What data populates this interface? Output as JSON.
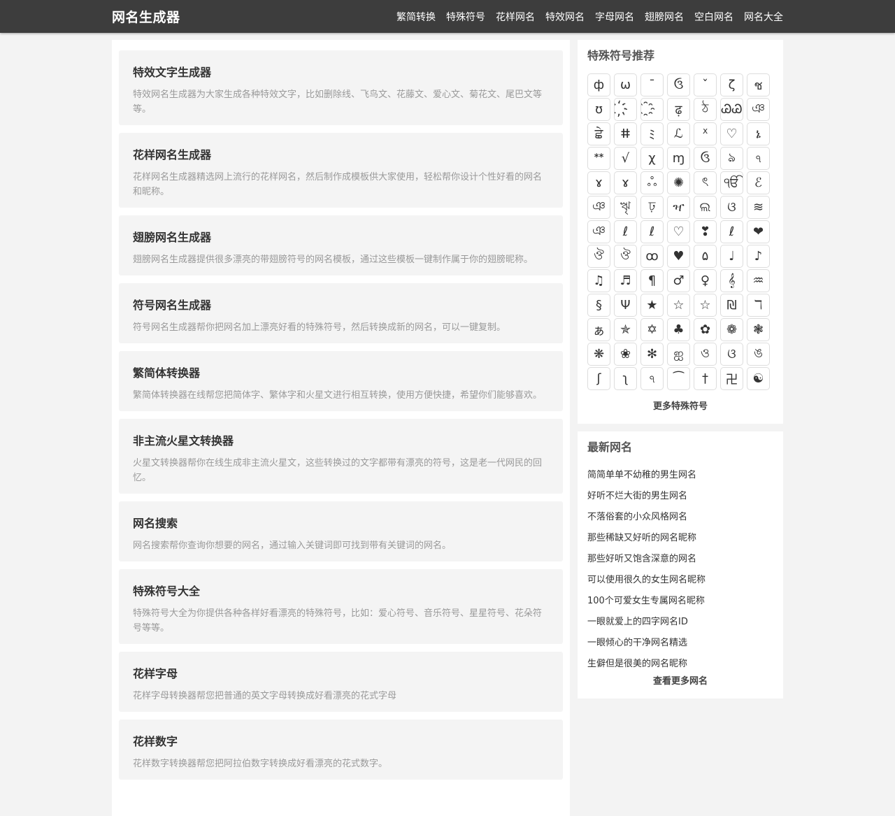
{
  "header": {
    "brand": "网名生成器",
    "nav": [
      "繁简转换",
      "特殊符号",
      "花样网名",
      "特效网名",
      "字母网名",
      "翅膀网名",
      "空白网名",
      "网名大全"
    ]
  },
  "tools": [
    {
      "title": "特效文字生成器",
      "desc": "特效网名生成器为大家生成各种特效文字，比如删除线、飞鸟文、花藤文、爱心文、菊花文、尾巴文等等。"
    },
    {
      "title": "花样网名生成器",
      "desc": "花样网名生成器精选网上流行的花样网名，然后制作成模板供大家使用，轻松帮你设计个性好看的网名和昵称。"
    },
    {
      "title": "翅膀网名生成器",
      "desc": "翅膀网名生成器提供很多漂亮的带翅膀符号的网名模板，通过这些模板一键制作属于你的翅膀昵称。"
    },
    {
      "title": "符号网名生成器",
      "desc": "符号网名生成器帮你把网名加上漂亮好看的特殊符号，然后转换成新的网名，可以一键复制。"
    },
    {
      "title": "繁简体转换器",
      "desc": "繁简体转换器在线帮您把简体字、繁体字和火星文进行相互转换，使用方便快捷，希望你们能够喜欢。"
    },
    {
      "title": "非主流火星文转换器",
      "desc": "火星文转换器帮你在线生成非主流火星文，这些转换过的文字都带有漂亮的符号，这是老一代网民的回忆。"
    },
    {
      "title": "网名搜索",
      "desc": "网名搜索帮你查询你想要的网名，通过输入关键词即可找到带有关键词的网名。"
    },
    {
      "title": "特殊符号大全",
      "desc": "特殊符号大全为你提供各种各样好看漂亮的特殊符号，比如：爱心符号、音乐符号、星星符号、花朵符号等等。"
    },
    {
      "title": "花样字母",
      "desc": "花样字母转换器帮您把普通的英文字母转换成好看漂亮的花式字母"
    },
    {
      "title": "花样数字",
      "desc": "花样数字转换器帮您把阿拉伯数字转换成好看漂亮的花式数字。"
    }
  ],
  "symbols_panel": {
    "title": "特殊符号推荐",
    "symbols": [
      "ф",
      "ω",
      "ˉ",
      "ઉ",
      "ˇ",
      "ζ",
      "ช",
      "ʊ",
      "҉",
      "҈",
      "ढ़",
      "ঠ",
      "ᏊᏊ",
      "ঞ",
      "ਛੇ",
      "ⵌ",
      "ﾐ",
      "ℒ",
      "ᕽ",
      "♡",
      "ኔ",
      "ᕯ",
      "√",
      "χ",
      "ɱ",
      "ઉ",
      "ঌ",
      "ঀ",
      "ɤ",
      "ɤ",
      "ஃ",
      "✺",
      "ৎ",
      "ੴ",
      "ℰ",
      "ঞ",
      "ৠ",
      "ঢ়",
      "ዣ",
      "ଲ",
      "ଓ",
      "≋",
      "ঞ",
      "ℓ",
      "ℓ",
      "♡",
      "❣",
      "ℓ",
      "❤",
      "ঔ",
      "ঔ",
      "ꝏ",
      "♥",
      "۵",
      "♩",
      "♪",
      "♫",
      "♬",
      "¶",
      "♂",
      "♀",
      "𝄞",
      "♒",
      "§",
      "Ψ",
      "★",
      "☆",
      "☆",
      "₪",
      "ℸ",
      "ぁ",
      "✯",
      "✡",
      "♣",
      "✿",
      "❁",
      "❃",
      "❋",
      "❀",
      "✻",
      "ஐ",
      "ও",
      "ଓ",
      "ঙ",
      "ʃ",
      "ʅ",
      "ঀ",
      "⁀",
      "†",
      "卍",
      "☯"
    ],
    "more": "更多特殊符号"
  },
  "names_panel": {
    "title": "最新网名",
    "items": [
      "简简单单不幼稚的男生网名",
      "好听不烂大街的男生网名",
      "不落俗套的小众风格网名",
      "那些稀缺又好听的网名昵称",
      "那些好听又饱含深意的网名",
      "可以使用很久的女生网名昵称",
      "100个可爱女生专属网名昵称",
      "一眼就爱上的四字网名ID",
      "一眼倾心的干净网名精选",
      "生僻但是很美的网名昵称"
    ],
    "more": "查看更多网名"
  }
}
